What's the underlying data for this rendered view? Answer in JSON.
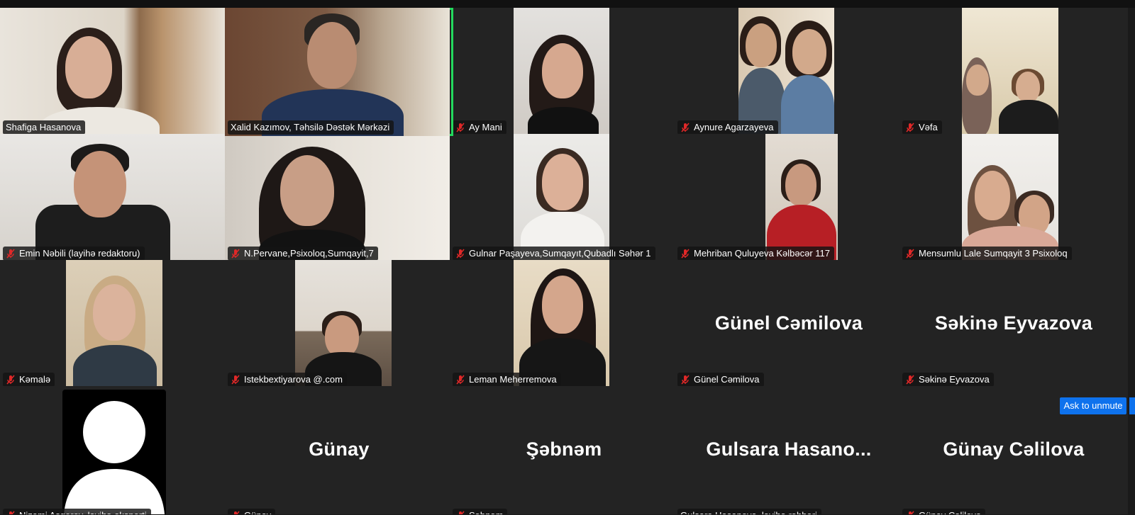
{
  "participants": [
    {
      "name": "Shafiga Hasanova",
      "muted": false,
      "big": "",
      "active": false
    },
    {
      "name": "Xalid Kazımov, Təhsilə Dəstək Mərkəzi",
      "muted": false,
      "big": "",
      "active": true
    },
    {
      "name": "Ay Mani",
      "muted": true,
      "big": "",
      "active": false
    },
    {
      "name": "Aynure Agarzayeva",
      "muted": true,
      "big": "",
      "active": false
    },
    {
      "name": "Vəfa",
      "muted": true,
      "big": "",
      "active": false
    },
    {
      "name": "Emin Nəbili (layihə redaktoru)",
      "muted": true,
      "big": "",
      "active": false
    },
    {
      "name": "N.Pervane,Psixoloq,Sumqayit,7",
      "muted": true,
      "big": "",
      "active": false
    },
    {
      "name": "Gulnar Paşayeva,Sumqayıt,Qubadlı Səhər 1",
      "muted": true,
      "big": "",
      "active": false
    },
    {
      "name": "Mehriban Quluyeva Kəlbəcər 117",
      "muted": true,
      "big": "",
      "active": false
    },
    {
      "name": "Mensumlu Lale Sumqayit 3 Psixoloq",
      "muted": true,
      "big": "",
      "active": false
    },
    {
      "name": "Kəmalə",
      "muted": true,
      "big": "",
      "active": false
    },
    {
      "name": "Istekbextiyarova @.com",
      "muted": true,
      "big": "",
      "active": false
    },
    {
      "name": "Leman Meherremova",
      "muted": true,
      "big": "",
      "active": false
    },
    {
      "name": "Günel Cəmilova",
      "muted": true,
      "big": "Günel Cəmilova",
      "active": false
    },
    {
      "name": "Səkinə Eyvazova",
      "muted": true,
      "big": "Səkinə Eyvazova",
      "active": false
    },
    {
      "name": "Nizami Asgerov, layihə eksperti",
      "muted": true,
      "big": "",
      "active": false
    },
    {
      "name": "Günay",
      "muted": true,
      "big": "Günay",
      "active": false
    },
    {
      "name": "Şəbnəm",
      "muted": true,
      "big": "Şəbnəm",
      "active": false
    },
    {
      "name": "Gulsara Hasanova, layihə rəhbəri",
      "muted": false,
      "big": "Gulsara  Hasano...",
      "active": false
    },
    {
      "name": "Günay Cəlilova",
      "muted": true,
      "big": "Günay Cəlilova",
      "active": false
    }
  ],
  "ask_to_unmute": "Ask to unmute",
  "colors": {
    "active_border": "#23d95d",
    "muted_icon": "#e02828",
    "button": "#0e72ed"
  }
}
